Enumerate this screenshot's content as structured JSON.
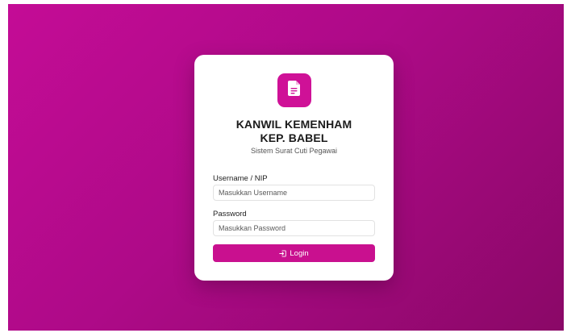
{
  "app": {
    "title_line1": "KANWIL KEMENHAM",
    "title_line2": "KEP. BABEL",
    "subtitle": "Sistem Surat Cuti Pegawai",
    "logo_icon": "document-icon"
  },
  "form": {
    "username_label": "Username / NIP",
    "username_placeholder": "Masukkan Username",
    "username_value": "",
    "password_label": "Password",
    "password_placeholder": "Masukkan Password",
    "password_value": "",
    "login_label": "Login",
    "login_icon": "login-icon"
  },
  "colors": {
    "background_start": "#c40c96",
    "background_end": "#8a0867",
    "accent": "#c9108f",
    "card": "#ffffff"
  }
}
